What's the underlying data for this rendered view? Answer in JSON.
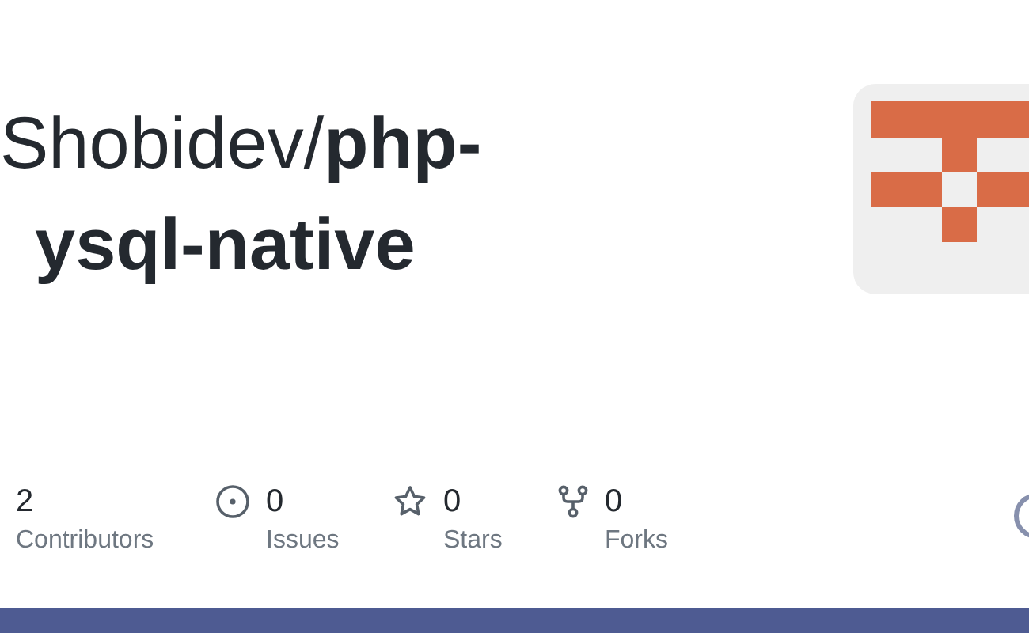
{
  "title_lines": [
    "Shobidev/**php-**",
    "**ysql-native**"
  ],
  "stats": [
    {
      "kind": "contributors",
      "value": "2",
      "label": "Contributors"
    },
    {
      "kind": "issues",
      "value": "0",
      "label": "Issues"
    },
    {
      "kind": "stars",
      "value": "0",
      "label": "Stars"
    },
    {
      "kind": "forks",
      "value": "0",
      "label": "Forks"
    }
  ]
}
